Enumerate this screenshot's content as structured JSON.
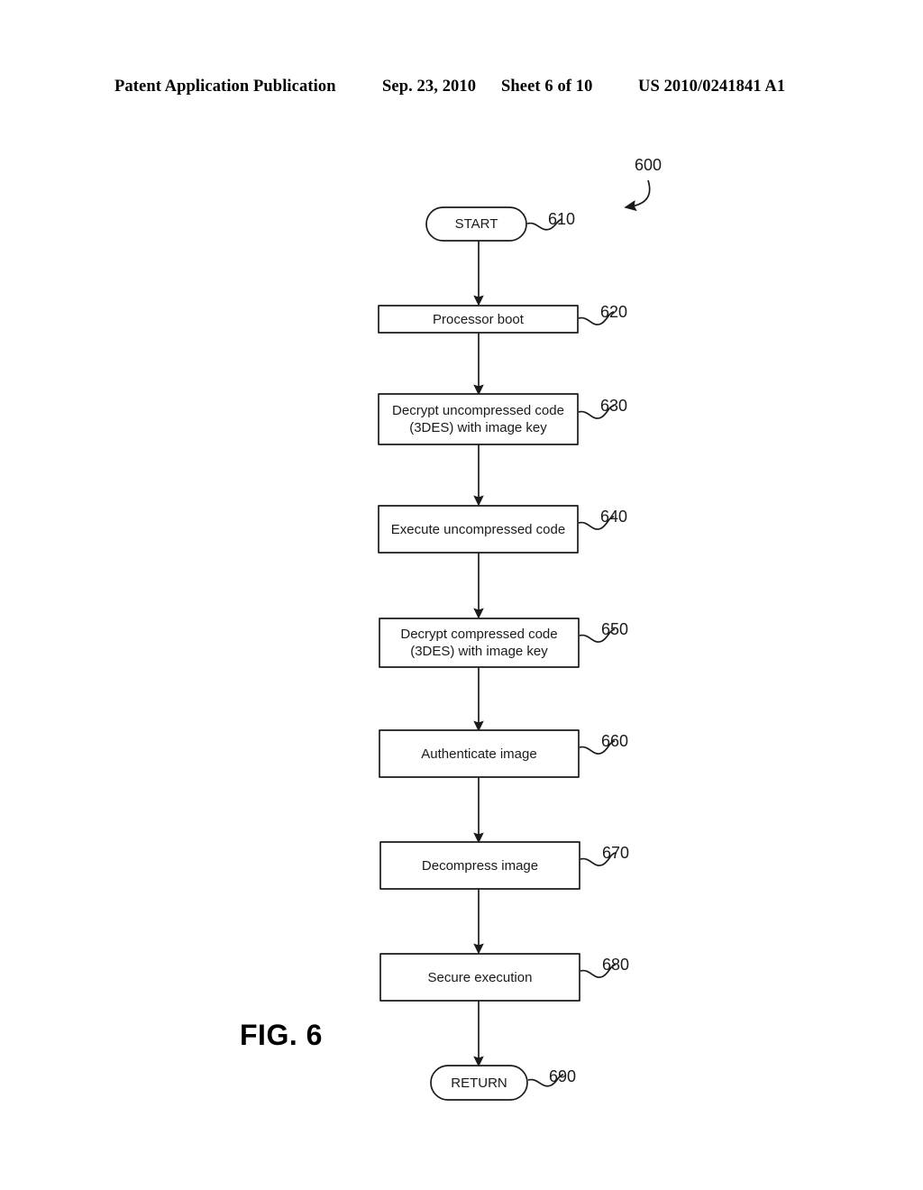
{
  "header": {
    "publication": "Patent Application Publication",
    "date": "Sep. 23, 2010",
    "sheet": "Sheet 6 of 10",
    "patent_number": "US 2010/0241841 A1"
  },
  "figure": {
    "caption": "FIG. 6",
    "diagram_ref": "600",
    "type": "flowchart",
    "orientation": "vertical-top-to-bottom",
    "stroke_color": "#1a1a1a",
    "fill_color": "#ffffff",
    "nodes": [
      {
        "ref": "610",
        "shape": "terminator",
        "label": "START"
      },
      {
        "ref": "620",
        "shape": "process",
        "label": "Processor boot"
      },
      {
        "ref": "630",
        "shape": "process",
        "label": "Decrypt uncompressed code\n(3DES) with image key"
      },
      {
        "ref": "640",
        "shape": "process",
        "label": "Execute uncompressed code"
      },
      {
        "ref": "650",
        "shape": "process",
        "label": "Decrypt compressed code\n(3DES) with image key"
      },
      {
        "ref": "660",
        "shape": "process",
        "label": "Authenticate image"
      },
      {
        "ref": "670",
        "shape": "process",
        "label": "Decompress image"
      },
      {
        "ref": "680",
        "shape": "process",
        "label": "Secure execution"
      },
      {
        "ref": "690",
        "shape": "terminator",
        "label": "RETURN"
      }
    ],
    "edges": [
      {
        "from": "610",
        "to": "620"
      },
      {
        "from": "620",
        "to": "630"
      },
      {
        "from": "630",
        "to": "640"
      },
      {
        "from": "640",
        "to": "650"
      },
      {
        "from": "650",
        "to": "660"
      },
      {
        "from": "660",
        "to": "670"
      },
      {
        "from": "670",
        "to": "680"
      },
      {
        "from": "680",
        "to": "690"
      }
    ]
  }
}
